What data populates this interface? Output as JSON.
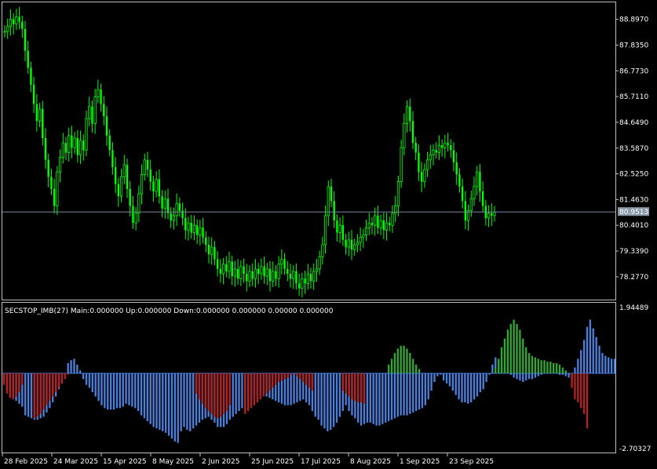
{
  "main_chart": {
    "price_ticks": [
      "88.8970",
      "87.8350",
      "86.7730",
      "85.7110",
      "84.6490",
      "83.5870",
      "82.5250",
      "81.4630",
      "80.4010",
      "79.3390",
      "78.2770"
    ],
    "current_price": "80.9513",
    "price_range": [
      77.4,
      89.5
    ],
    "candle_color": "#00ff00",
    "current_line_color": "#778899"
  },
  "indicator": {
    "title": "SECSTOP_IMB(27) Main:0.000000  Up:0.000000  Down:0.000000 0.000000 0.00000 0.000000",
    "max_label": "1.94489",
    "min_label": "-2.70327",
    "range": [
      -2.70327,
      1.94489
    ],
    "colors": {
      "main": "#4a7fdb",
      "up": "#32a832",
      "down": "#b22222"
    }
  },
  "time_axis": {
    "labels": [
      "28 Feb 2025",
      "24 Mar 2025",
      "15 Apr 2025",
      "8 May 2025",
      "2 Jun 2025",
      "25 Jun 2025",
      "17 Jul 2025",
      "8 Aug 2025",
      "1 Sep 2025",
      "23 Sep 2025"
    ]
  },
  "chart_data": {
    "type": "candlestick",
    "price_closes": [
      88.4,
      88.6,
      88.9,
      88.7,
      89.0,
      88.8,
      88.5,
      87.6,
      86.9,
      86.2,
      85.4,
      84.7,
      85.2,
      84.0,
      83.1,
      82.4,
      81.9,
      81.2,
      82.6,
      83.2,
      83.8,
      83.4,
      84.1,
      83.6,
      84.0,
      83.3,
      83.9,
      83.5,
      84.8,
      85.3,
      84.6,
      85.7,
      86.0,
      85.4,
      84.9,
      84.1,
      83.5,
      82.8,
      82.1,
      81.6,
      82.4,
      82.9,
      81.9,
      81.2,
      80.5,
      80.9,
      81.7,
      82.5,
      83.1,
      82.7,
      82.2,
      81.8,
      82.3,
      81.6,
      81.1,
      81.5,
      80.9,
      80.6,
      80.8,
      81.3,
      81.0,
      80.7,
      80.2,
      80.5,
      80.1,
      80.4,
      80.0,
      80.3,
      79.9,
      79.6,
      79.2,
      79.5,
      79.0,
      78.6,
      78.4,
      78.8,
      78.5,
      78.9,
      78.3,
      78.6,
      78.2,
      78.7,
      78.4,
      78.1,
      78.5,
      78.2,
      78.6,
      78.4,
      78.7,
      78.3,
      78.6,
      78.1,
      78.5,
      78.2,
      78.8,
      79.0,
      78.6,
      78.4,
      78.2,
      78.5,
      78.0,
      77.8,
      78.2,
      78.0,
      78.4,
      78.1,
      78.5,
      78.6,
      79.1,
      79.6,
      80.8,
      82.0,
      81.4,
      80.6,
      80.1,
      80.4,
      79.8,
      79.5,
      79.8,
      79.4,
      79.6,
      79.7,
      79.9,
      80.0,
      80.3,
      80.5,
      80.4,
      80.8,
      80.3,
      80.6,
      80.2,
      80.5,
      80.4,
      80.9,
      81.2,
      82.2,
      83.6,
      84.6,
      85.3,
      84.7,
      83.8,
      83.4,
      82.6,
      82.2,
      82.7,
      83.1,
      83.3,
      83.5,
      83.4,
      83.7,
      83.6,
      83.8,
      83.7,
      83.5,
      83.0,
      82.5,
      82.0,
      81.4,
      80.6,
      81.0,
      81.5,
      82.0,
      82.6,
      81.8,
      81.2,
      80.7,
      80.9,
      80.8,
      80.95
    ],
    "indicator_main": [
      -0.25,
      -0.55,
      -0.7,
      -0.8,
      -0.95,
      -1.05,
      -1.15,
      -1.45,
      -1.5,
      -1.55,
      -1.6,
      -1.6,
      -1.55,
      -1.5,
      -1.35,
      -1.2,
      -1.0,
      -0.8,
      -0.55,
      -0.35,
      0.0,
      0.35,
      0.45,
      0.5,
      0.3,
      0.1,
      -0.2,
      -0.4,
      -0.5,
      -0.65,
      -0.8,
      -0.95,
      -1.1,
      -1.2,
      -1.25,
      -1.25,
      -1.25,
      -1.2,
      -1.2,
      -1.15,
      -1.05,
      -1.1,
      -1.15,
      -1.2,
      -1.3,
      -1.45,
      -1.55,
      -1.65,
      -1.75,
      -1.85,
      -1.9,
      -1.95,
      -2.0,
      -2.05,
      -2.15,
      -2.25,
      -2.35,
      -2.4,
      -2.0,
      -1.85,
      -1.95,
      -2.0,
      -1.9,
      -1.8,
      -1.7,
      -1.6,
      -1.55,
      -1.5,
      -1.6,
      -1.7,
      -1.85,
      -1.85,
      -1.85,
      -1.75,
      -1.6,
      -1.5,
      -1.4,
      -1.3,
      -1.2,
      -1.1,
      -1.0,
      -0.95,
      -0.85,
      -0.8,
      -0.75,
      -0.75,
      -0.8,
      -0.85,
      -0.9,
      -0.95,
      -1.0,
      -1.05,
      -1.1,
      -1.1,
      -1.1,
      -1.05,
      -1.0,
      -0.95,
      -0.9,
      -1.0,
      -1.1,
      -1.3,
      -1.5,
      -1.6,
      -1.8,
      -1.9,
      -2.0,
      -1.95,
      -1.85,
      -1.7,
      -1.5,
      -1.3,
      -1.1,
      -1.3,
      -1.45,
      -1.55,
      -1.7,
      -1.8,
      -1.75,
      -1.7,
      -1.7,
      -1.75,
      -1.8,
      -1.8,
      -1.75,
      -1.7,
      -1.65,
      -1.6,
      -1.55,
      -1.5,
      -1.45,
      -1.45,
      -1.45,
      -1.4,
      -1.35,
      -1.3,
      -1.25,
      -1.2,
      -1.1,
      -0.9,
      -0.6,
      -0.3,
      -0.1,
      -0.05,
      -0.25,
      -0.35,
      -0.45,
      -0.6,
      -0.75,
      -0.9,
      -1.0,
      -1.0,
      -1.05,
      -1.0,
      -0.9,
      -0.8,
      -0.65,
      -0.55,
      -0.3,
      -0.05,
      0.3,
      0.55,
      0.45,
      0.3,
      0.2,
      0.05,
      -0.05,
      -0.15,
      -0.2,
      -0.25,
      -0.3,
      -0.25,
      -0.2,
      -0.2,
      -0.15,
      -0.1,
      -0.05,
      0.0,
      0.0,
      0.0,
      0.0,
      0.0,
      -0.05,
      -0.05,
      -0.1,
      -0.15,
      -0.2,
      0.2,
      0.5,
      0.8,
      1.15,
      1.6,
      1.85,
      1.55,
      1.25,
      0.95,
      0.7,
      0.6,
      0.55,
      0.5,
      0.5
    ],
    "indicator_up": [
      0,
      0,
      0,
      0,
      0,
      0,
      0,
      0,
      0,
      0,
      0,
      0,
      0,
      0,
      0,
      0,
      0,
      0,
      0,
      0,
      0,
      0,
      0,
      0,
      0,
      0,
      0,
      0,
      0,
      0,
      0,
      0,
      0,
      0,
      0,
      0,
      0,
      0,
      0,
      0,
      0,
      0,
      0,
      0,
      0,
      0,
      0,
      0,
      0,
      0,
      0,
      0,
      0,
      0,
      0,
      0,
      0,
      0,
      0,
      0,
      0,
      0,
      0,
      0,
      0,
      0,
      0,
      0,
      0,
      0,
      0,
      0,
      0,
      0,
      0,
      0,
      0,
      0,
      0,
      0,
      0,
      0,
      0,
      0,
      0,
      0,
      0,
      0,
      0,
      0,
      0,
      0,
      0,
      0,
      0,
      0,
      0,
      0,
      0,
      0,
      0,
      0,
      0,
      0,
      0,
      0,
      0,
      0,
      0,
      0,
      0,
      0,
      0,
      0,
      0,
      0,
      0,
      0,
      0,
      0,
      0,
      0,
      0,
      0,
      0,
      0,
      0,
      0,
      0,
      0,
      0,
      0,
      0,
      0,
      0,
      0,
      0,
      0,
      0,
      0,
      0,
      0,
      0,
      0,
      0,
      0,
      0,
      0,
      0,
      0,
      0,
      0,
      0,
      0,
      0,
      0,
      0,
      0,
      0,
      0,
      0,
      0,
      0,
      0,
      0,
      0,
      0,
      0,
      0,
      0,
      0,
      0,
      0,
      0,
      0,
      0,
      0,
      0,
      0,
      0,
      0,
      0,
      0,
      0,
      0,
      0,
      0,
      0,
      0,
      0,
      0,
      0,
      0,
      0,
      0,
      0,
      0,
      0,
      0,
      0,
      0,
      0,
      0,
      0,
      0
    ],
    "indicator_up_segments": [
      {
        "start": 126,
        "values": [
          0.3,
          0.5,
          0.7,
          0.85,
          0.95,
          0.95,
          0.85,
          0.7,
          0.5,
          0.3,
          0.15
        ]
      },
      {
        "start": 161,
        "values": [
          0.2,
          0.5,
          0.9,
          1.2,
          1.5,
          1.7,
          1.85,
          1.7,
          1.5,
          1.2,
          0.9,
          0.7,
          0.6,
          0.55,
          0.5,
          0.45,
          0.45,
          0.4,
          0.4,
          0.35,
          0.35,
          0.3,
          0.2,
          0.1
        ]
      }
    ],
    "indicator_down_segments": [
      {
        "start": 0,
        "values": [
          -0.4,
          -0.7,
          -0.85,
          -0.9,
          -0.8,
          -0.65,
          -0.4
        ]
      },
      {
        "start": 10,
        "values": [
          -1.55,
          -1.5,
          -1.4,
          -1.25,
          -1.1,
          -0.95,
          -0.8,
          -0.65,
          -0.5,
          -0.35,
          -0.2,
          -0.05
        ]
      },
      {
        "start": 63,
        "values": [
          -0.7,
          -0.9,
          -1.05,
          -1.2,
          -1.3,
          -1.4,
          -1.5,
          -1.55,
          -1.5,
          -1.4,
          -1.3,
          -1.1
        ]
      },
      {
        "start": 79,
        "values": [
          -1.4,
          -1.3,
          -1.2,
          -1.1,
          -1.0,
          -0.9,
          -0.8,
          -0.7,
          -0.6,
          -0.5,
          -0.4,
          -0.3,
          -0.25,
          -0.2,
          -0.15,
          -0.05,
          0.0,
          -0.1,
          -0.2,
          -0.3,
          -0.4,
          -0.5,
          -0.6
        ]
      },
      {
        "start": 111,
        "values": [
          -0.6,
          -0.7,
          -0.8,
          -0.9,
          -0.95,
          -1.0,
          -1.0,
          -1.05
        ]
      },
      {
        "start": 186,
        "values": [
          -0.5,
          -0.9,
          -1.0,
          -1.2,
          -1.4,
          -1.9
        ]
      }
    ]
  }
}
